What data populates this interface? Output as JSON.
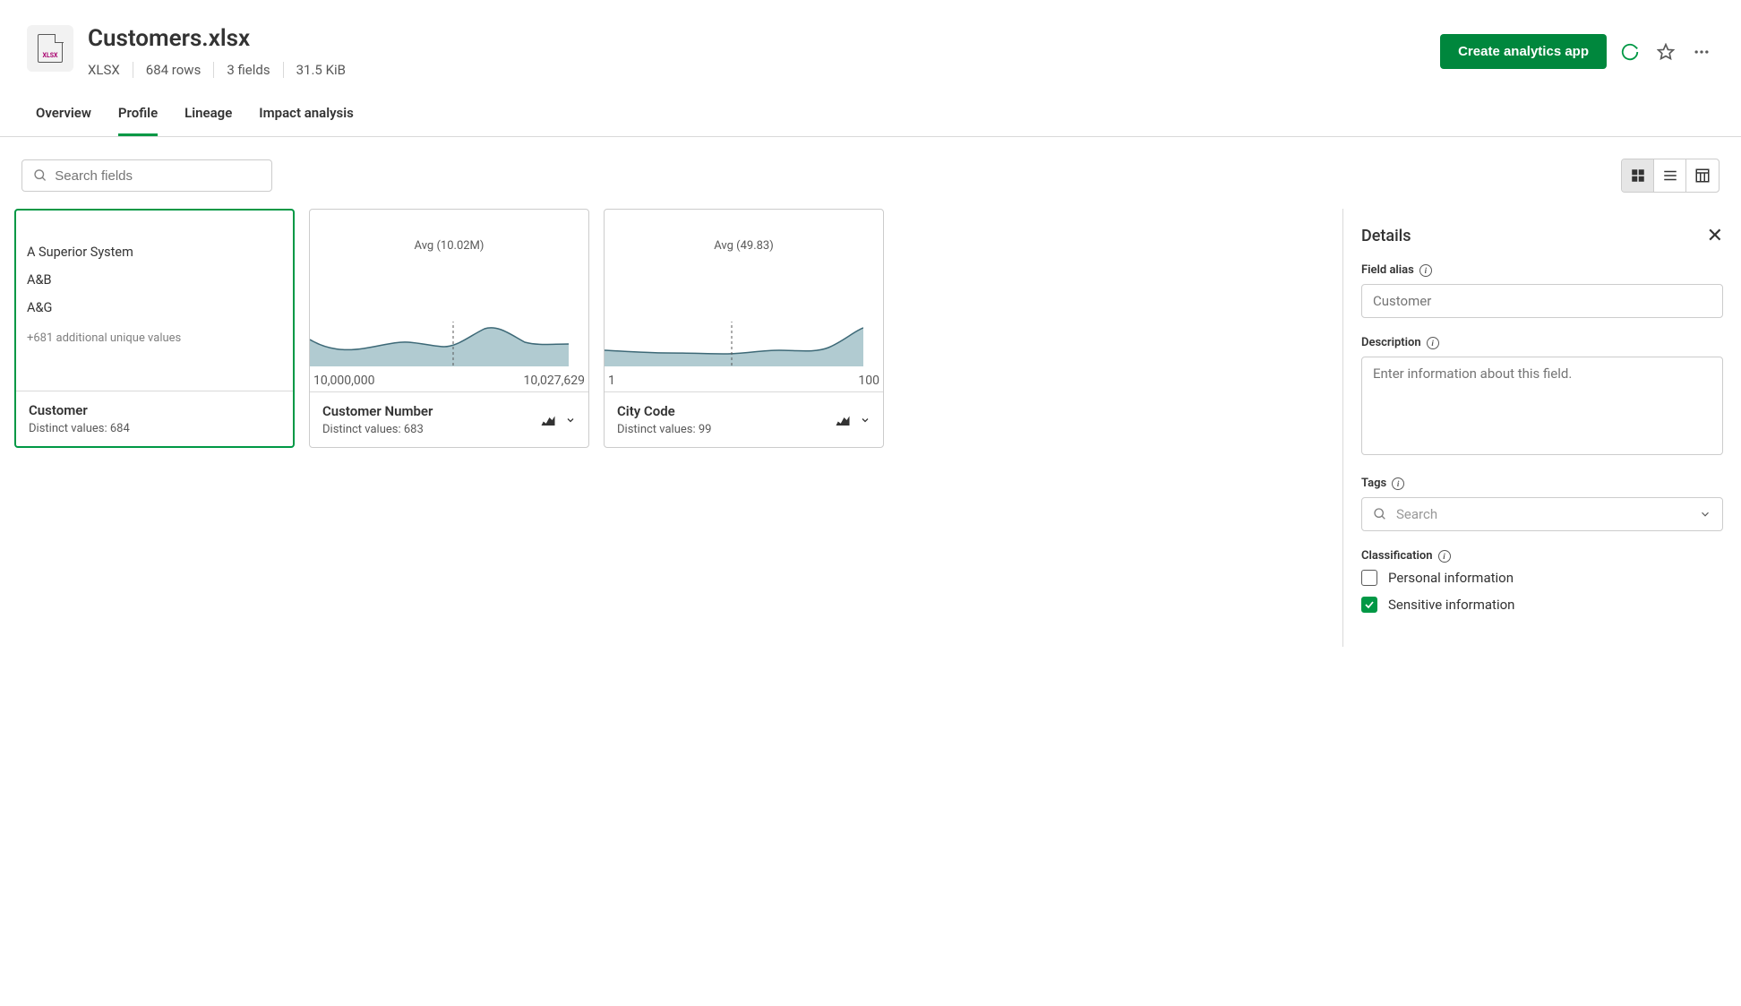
{
  "header": {
    "title": "Customers.xlsx",
    "file_type": "XLSX",
    "rows": "684 rows",
    "fields": "3 fields",
    "size": "31.5 KiB",
    "create_button": "Create analytics app",
    "file_badge": "XLSX"
  },
  "tabs": [
    {
      "label": "Overview",
      "active": false
    },
    {
      "label": "Profile",
      "active": true
    },
    {
      "label": "Lineage",
      "active": false
    },
    {
      "label": "Impact analysis",
      "active": false
    }
  ],
  "search_placeholder": "Search fields",
  "fields": [
    {
      "name": "Customer",
      "distinct": "Distinct values: 684",
      "values": [
        "A Superior System",
        "A&B",
        "A&G"
      ],
      "extra": "+681 additional unique values",
      "selected": true
    },
    {
      "name": "Customer Number",
      "distinct": "Distinct values: 683",
      "avg_label": "Avg (10.02M)",
      "range_min": "10,000,000",
      "range_max": "10,027,629",
      "selected": false
    },
    {
      "name": "City Code",
      "distinct": "Distinct values: 99",
      "avg_label": "Avg (49.83)",
      "range_min": "1",
      "range_max": "100",
      "selected": false
    }
  ],
  "details": {
    "title": "Details",
    "alias_label": "Field alias",
    "alias_placeholder": "Customer",
    "description_label": "Description",
    "description_placeholder": "Enter information about this field.",
    "tags_label": "Tags",
    "tags_placeholder": "Search",
    "classification_label": "Classification",
    "classification_options": [
      {
        "label": "Personal information",
        "checked": false
      },
      {
        "label": "Sensitive information",
        "checked": true
      }
    ]
  },
  "chart_data": [
    {
      "type": "area",
      "field": "Customer Number",
      "x_approx": [
        10000000,
        10003000,
        10006000,
        10008500,
        10011000,
        10013000,
        10015500,
        10018000,
        10020000,
        10022000,
        10024500,
        10027629
      ],
      "y_relative": [
        0.6,
        0.38,
        0.34,
        0.5,
        0.55,
        0.45,
        0.44,
        0.7,
        0.85,
        0.68,
        0.55,
        0.5
      ],
      "avg_value": 10020000,
      "avg_label": "Avg (10.02M)",
      "xlim": [
        10000000,
        10027629
      ]
    },
    {
      "type": "area",
      "field": "City Code",
      "x_approx": [
        1,
        10,
        20,
        30,
        40,
        50,
        60,
        70,
        80,
        90,
        100
      ],
      "y_relative": [
        0.36,
        0.34,
        0.3,
        0.3,
        0.28,
        0.28,
        0.34,
        0.36,
        0.3,
        0.42,
        0.85
      ],
      "avg_value": 49.83,
      "avg_label": "Avg (49.83)",
      "xlim": [
        1,
        100
      ]
    }
  ]
}
